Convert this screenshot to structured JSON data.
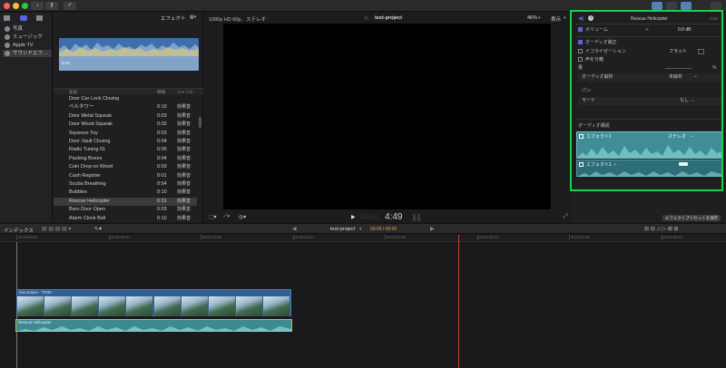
{
  "toolbar": {
    "effects_label": "エフェクト",
    "format_info": "1080p HD 60p、ステレオ",
    "project_name": "test-project",
    "zoom": "46%",
    "view_label": "表示"
  },
  "sidebar": {
    "items": [
      {
        "label": "写真"
      },
      {
        "label": "ミュージック"
      },
      {
        "label": "Apple TV"
      },
      {
        "label": "サウンドエフ…"
      }
    ]
  },
  "browser": {
    "waveform_time": "0:10",
    "columns": {
      "name": "名前",
      "duration": "時間",
      "genre": "ジャンル"
    },
    "rows": [
      {
        "name": "Door Car Lock Closing",
        "duration": "",
        "genre": ""
      },
      {
        "name": "ベルタワー",
        "duration": "0:10",
        "genre": "効果音"
      },
      {
        "name": "Door Metal Squeak",
        "duration": "0:03",
        "genre": "効果音"
      },
      {
        "name": "Door Wood Squeak",
        "duration": "0:02",
        "genre": "効果音"
      },
      {
        "name": "Squeeze Toy",
        "duration": "0:03",
        "genre": "効果音"
      },
      {
        "name": "Door Vault Closing",
        "duration": "0:04",
        "genre": "効果音"
      },
      {
        "name": "Radio Tuning 01",
        "duration": "0:05",
        "genre": "効果音"
      },
      {
        "name": "Packing Boxes",
        "duration": "0:04",
        "genre": "効果音"
      },
      {
        "name": "Coin Drop on Wood",
        "duration": "0:03",
        "genre": "効果音"
      },
      {
        "name": "Cash Register",
        "duration": "0:01",
        "genre": "効果音"
      },
      {
        "name": "Scuba Breathing",
        "duration": "0:54",
        "genre": "効果音"
      },
      {
        "name": "Bubbles",
        "duration": "0:10",
        "genre": "効果音"
      },
      {
        "name": "Rescue Helicopter",
        "duration": "0:31",
        "genre": "効果音",
        "selected": true
      },
      {
        "name": "Barn Door Open",
        "duration": "0:03",
        "genre": "効果音"
      },
      {
        "name": "Alarm Clock Bell",
        "duration": "0:10",
        "genre": "効果音"
      }
    ]
  },
  "viewer": {
    "timecode": "4:49"
  },
  "inspector": {
    "clip_name": "Rescue Helicopter",
    "clip_time": "0:00",
    "volume_label": "ボリューム",
    "volume_value": "0.0 dB",
    "audio_enhance_header": "オーディオ補正",
    "equalization_label": "イコライゼーション",
    "equalization_value": "フラット",
    "match_label": "声を分離",
    "amount_label": "量",
    "amount_value": "%",
    "analysis_label": "オーディオ解析",
    "analysis_value": "未解析",
    "pan_header": "パン",
    "mode_label": "モード",
    "mode_value": "なし",
    "config_header": "オーディオ構成",
    "effect1_label": "エフェクト1",
    "effect1_mode": "ステレオ",
    "effect2_label": "エフェクト1",
    "save_preset": "エフェクトプリセットを保存"
  },
  "timeline": {
    "index_label": "インデックス",
    "project_name": "test-project",
    "timecode": "00:00 / 00:00",
    "ticks": [
      "00:00:00:00",
      "00:00:05:00",
      "00:00:10:00",
      "00:00:15:00",
      "00:00:20:00",
      "00:00:25:00",
      "00:00:30:00",
      "00:00:35:00"
    ],
    "video_clip_label": "Mountains - TRIM",
    "audio_clip_label": "Rescue Helicopter"
  },
  "colors": {
    "accent": "#19d14a",
    "audio": "#4a9aa0",
    "selection": "#d9b431",
    "playhead": "#d23b3b"
  }
}
